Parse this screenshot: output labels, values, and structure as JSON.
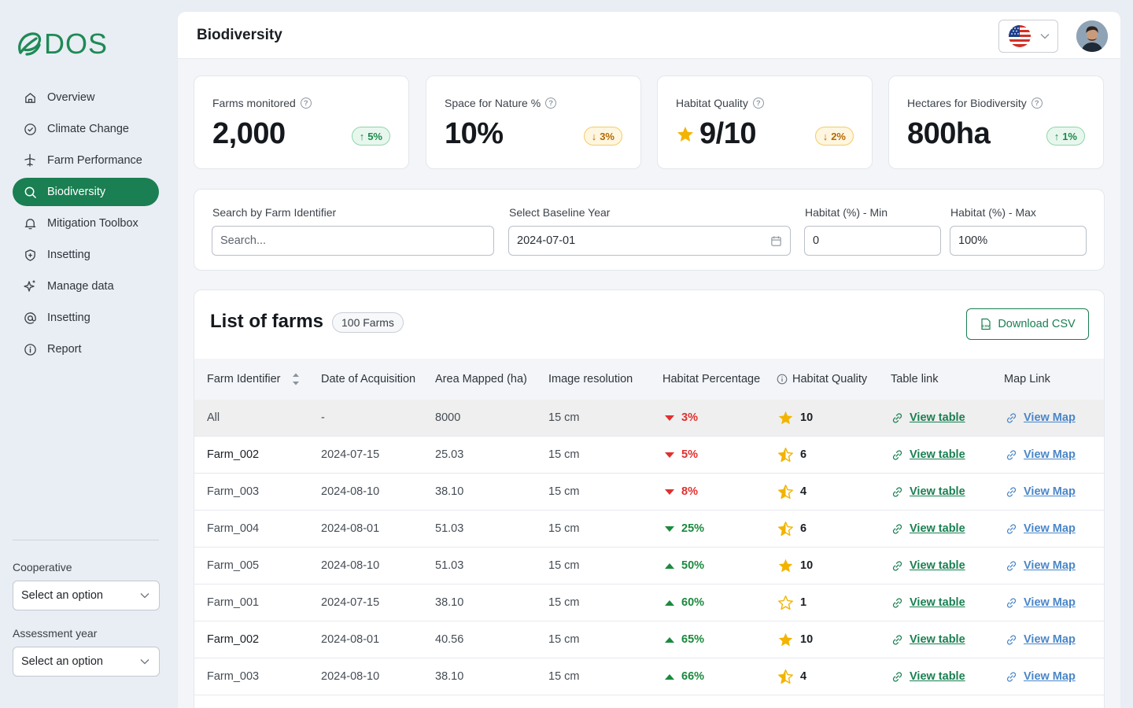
{
  "brand": {
    "name": "DOS"
  },
  "sidebar": {
    "items": [
      {
        "label": "Overview",
        "icon": "home-icon"
      },
      {
        "label": "Climate Change",
        "icon": "check-circle-icon"
      },
      {
        "label": "Farm Performance",
        "icon": "plane-icon"
      },
      {
        "label": "Biodiversity",
        "icon": "search-icon",
        "active": true
      },
      {
        "label": "Mitigation Toolbox",
        "icon": "bell-icon"
      },
      {
        "label": "Insetting",
        "icon": "shield-plus-icon"
      },
      {
        "label": "Manage data",
        "icon": "sparkle-icon"
      },
      {
        "label": "Insetting",
        "icon": "at-sign-icon"
      },
      {
        "label": "Report",
        "icon": "info-icon"
      }
    ],
    "cooperative_label": "Cooperative",
    "cooperative_value": "Select an option",
    "assessment_label": "Assessment year",
    "assessment_value": "Select an option"
  },
  "header": {
    "title": "Biodiversity",
    "language_flag": "us-flag-icon"
  },
  "kpis": [
    {
      "label": "Farms monitored",
      "value": "2,000",
      "change": "5%",
      "trend": "up"
    },
    {
      "label": "Space for Nature %",
      "value": "10%",
      "change": "3%",
      "trend": "down"
    },
    {
      "label": "Habitat Quality",
      "value": "9/10",
      "change": "2%",
      "trend": "down"
    },
    {
      "label": "Hectares for Biodiversity",
      "value": "800ha",
      "change": "1%",
      "trend": "up"
    }
  ],
  "filters": {
    "search_label": "Search by Farm Identifier",
    "search_placeholder": "Search...",
    "baseline_label": "Select Baseline Year",
    "baseline_value": "2024-07-01",
    "min_label": "Habitat (%) - Min",
    "min_value": "0",
    "max_label": "Habitat (%) - Max",
    "max_value": "100%"
  },
  "farm_list": {
    "title": "List of farms",
    "count": "100 Farms",
    "download_label": "Download CSV",
    "columns": [
      "Farm Identifier",
      "Date of Acquisition",
      "Area Mapped (ha)",
      "Image resolution",
      "Habitat Percentage",
      "Habitat Quality",
      "Table link",
      "Map Link"
    ],
    "rows": [
      {
        "id": "All",
        "date": "-",
        "area": "8000",
        "res": "15 cm",
        "pct": "3%",
        "trend": "down",
        "quality": "10",
        "star": "full",
        "table": "View table",
        "map": "View Map"
      },
      {
        "id": "Farm_002",
        "date": "2024-07-15",
        "area": "25.03",
        "res": "15 cm",
        "pct": "5%",
        "trend": "down",
        "quality": "6",
        "star": "half",
        "table": "View table",
        "map": "View Map"
      },
      {
        "id": "Farm_003",
        "date": "2024-08-10",
        "area": "38.10",
        "res": "15 cm",
        "pct": "8%",
        "trend": "down",
        "quality": "4",
        "star": "half",
        "table": "View table",
        "map": "View Map"
      },
      {
        "id": "Farm_004",
        "date": "2024-08-01",
        "area": "51.03",
        "res": "15 cm",
        "pct": "25%",
        "trend": "down-green",
        "quality": "6",
        "star": "half",
        "table": "View table",
        "map": "View Map"
      },
      {
        "id": "Farm_005",
        "date": "2024-08-10",
        "area": "51.03",
        "res": "15 cm",
        "pct": "50%",
        "trend": "up",
        "quality": "10",
        "star": "full",
        "table": "View table",
        "map": "View Map"
      },
      {
        "id": "Farm_001",
        "date": "2024-07-15",
        "area": "38.10",
        "res": "15 cm",
        "pct": "60%",
        "trend": "up",
        "quality": "1",
        "star": "empty",
        "table": "View table",
        "map": "View Map"
      },
      {
        "id": "Farm_002",
        "date": "2024-08-01",
        "area": "40.56",
        "res": "15 cm",
        "pct": "65%",
        "trend": "up",
        "quality": "10",
        "star": "full",
        "table": "View table",
        "map": "View Map"
      },
      {
        "id": "Farm_003",
        "date": "2024-08-10",
        "area": "38.10",
        "res": "15 cm",
        "pct": "66%",
        "trend": "up",
        "quality": "4",
        "star": "half",
        "table": "View table",
        "map": "View Map"
      }
    ]
  },
  "colors": {
    "brand_green": "#1a7f52",
    "down_red": "#e0302e",
    "up_green": "#1b8a3e",
    "star_gold": "#f2b400",
    "link_blue": "#4a86c8"
  }
}
